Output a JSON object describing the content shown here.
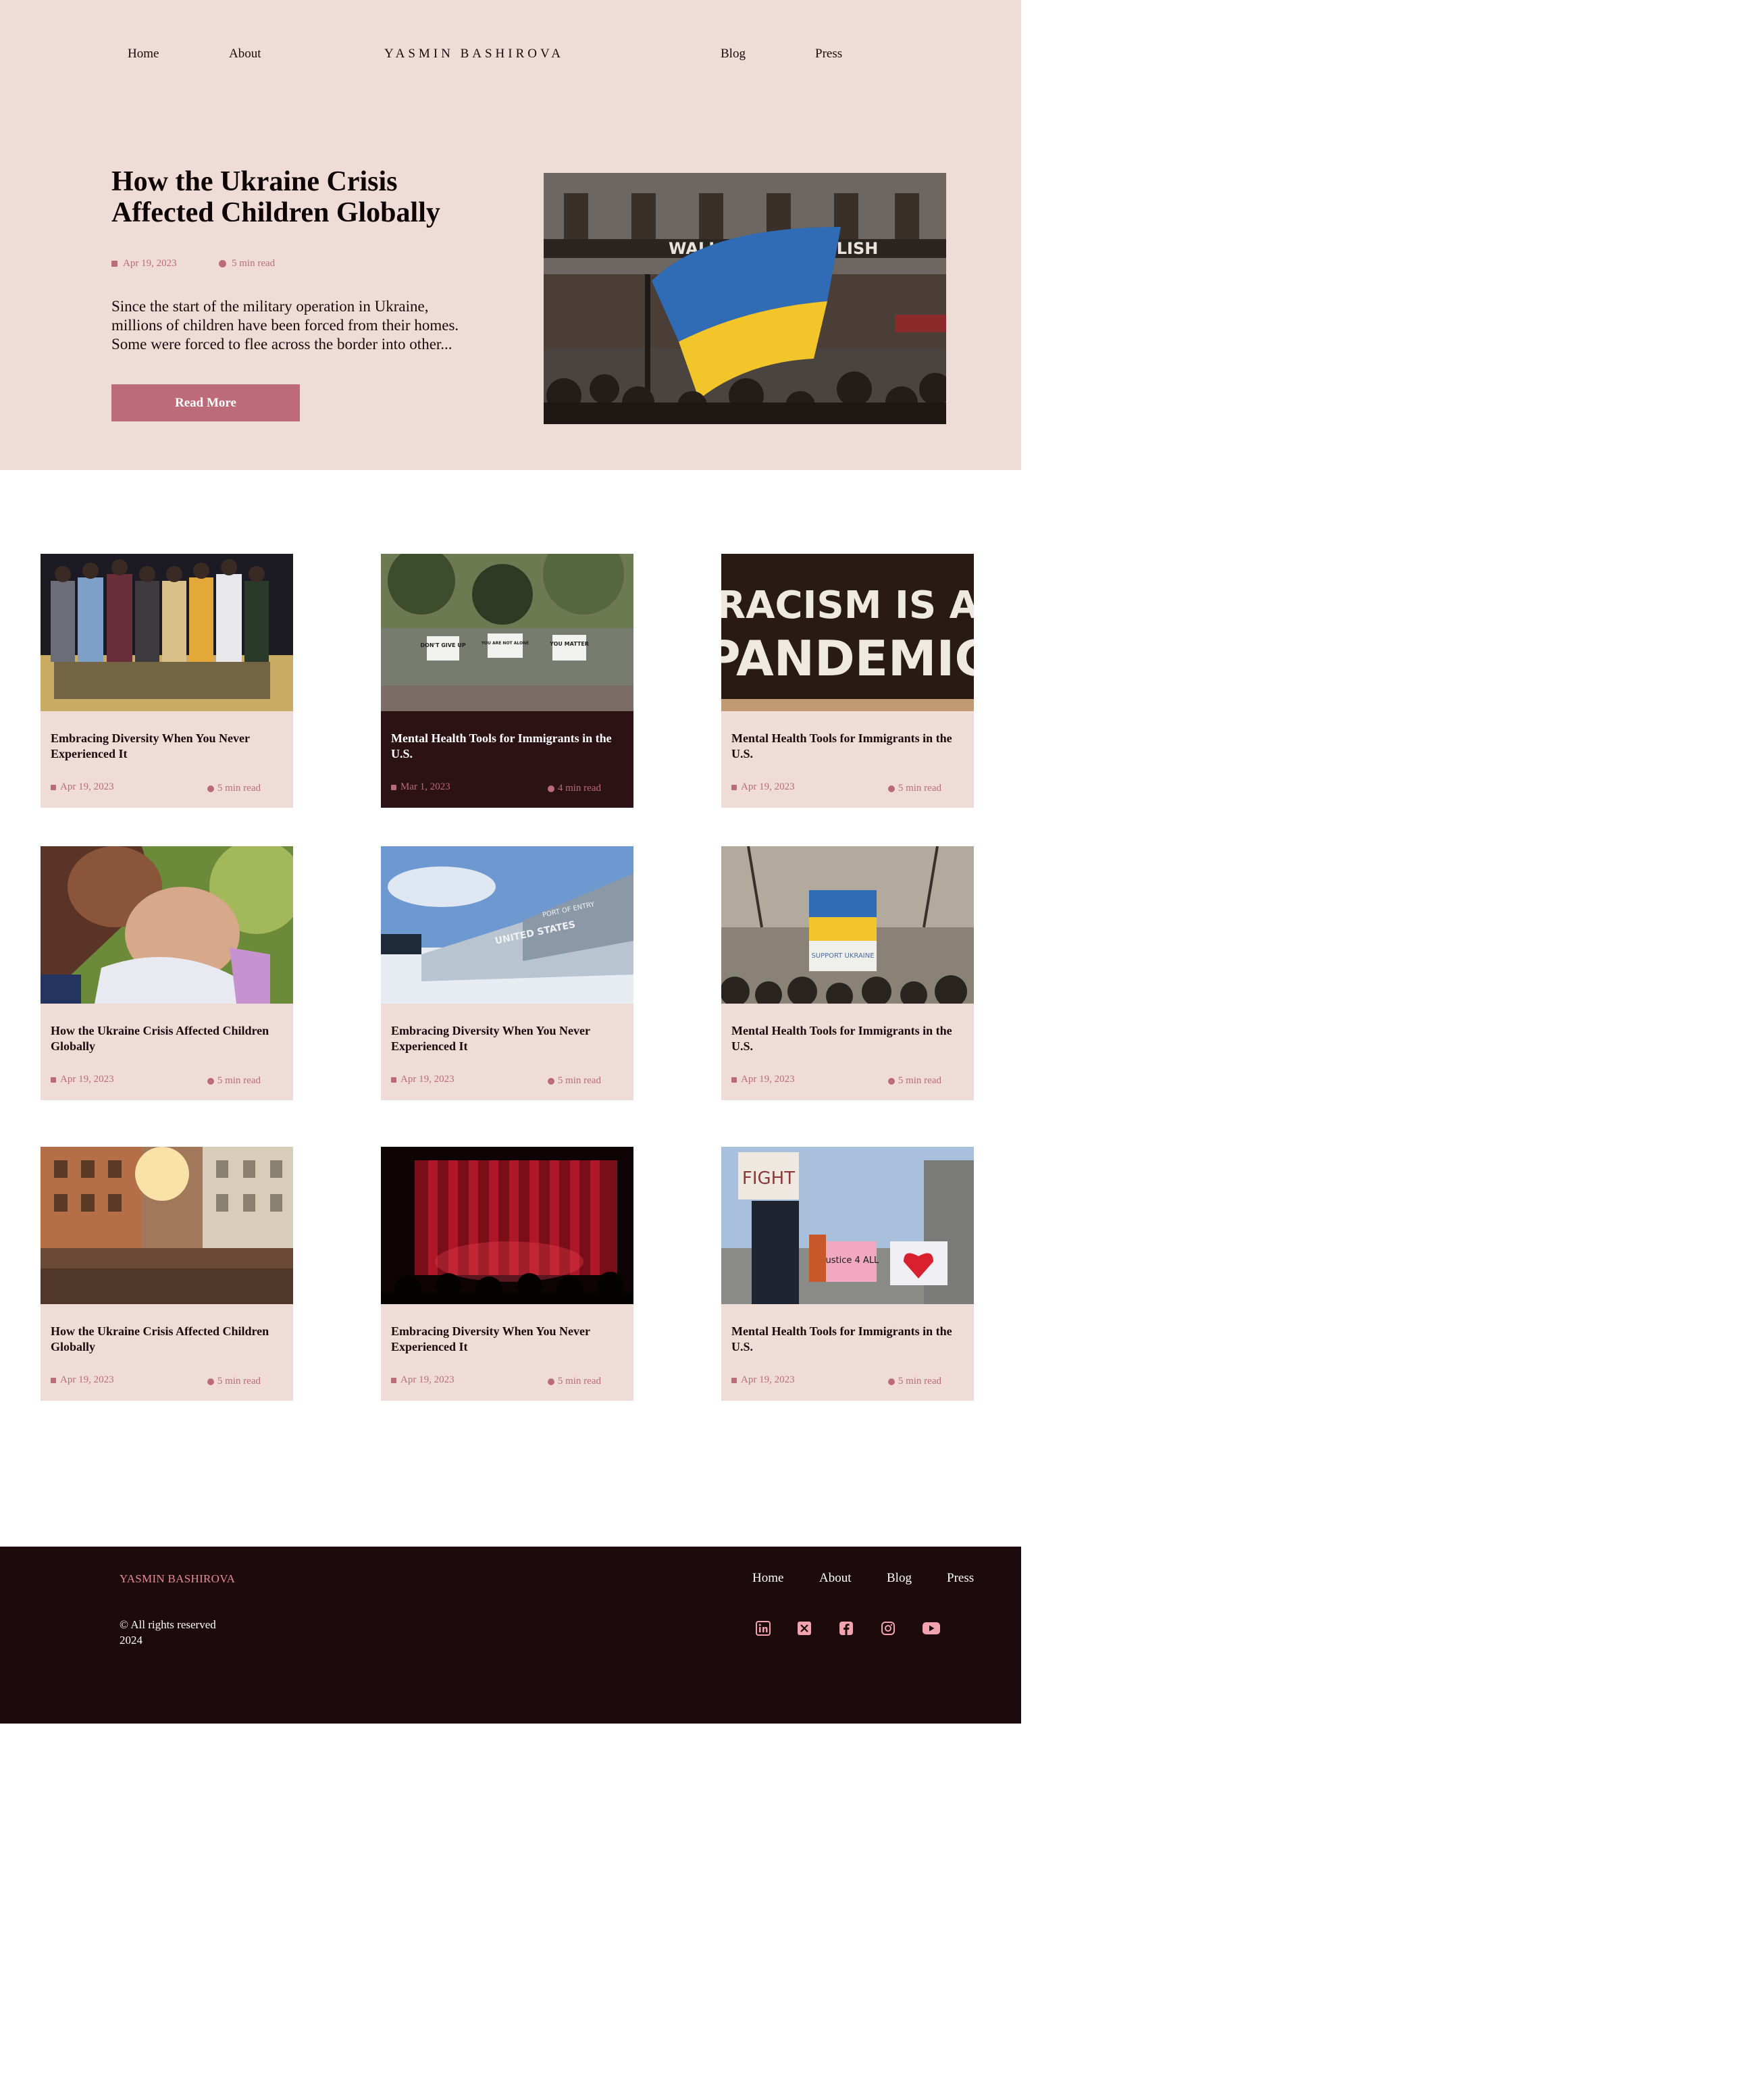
{
  "nav": {
    "home": "Home",
    "about": "About",
    "brand": "YASMIN BASHIROVA",
    "blog": "Blog",
    "press": "Press"
  },
  "hero": {
    "title": "How the Ukraine Crisis Affected Children Globally",
    "date": "Apr 19, 2023",
    "read_time": "5 min read",
    "excerpt": "Since the start of the military operation in Ukraine, millions of children have been forced from their homes. Some were forced to flee across the border into other...",
    "button": "Read More",
    "image_sign": "WALL STREET ENGLISH"
  },
  "cards": [
    {
      "title": "Embracing Diversity When You Never Experienced It",
      "date": "Apr 19, 2023",
      "read_time": "5 min read",
      "image": "group-hugging-photo"
    },
    {
      "title": "Mental Health Tools for Immigrants in the U.S.",
      "date": "Mar 1, 2023",
      "read_time": "4 min read",
      "image": "fence-signs-photo",
      "signs": [
        "DON'T GIVE UP",
        "YOU ARE NOT ALONE",
        "YOU MATTER"
      ]
    },
    {
      "title": "Mental Health Tools for Immigrants in the U.S.",
      "date": "Apr 19, 2023",
      "read_time": "5 min read",
      "image": "racism-sign-photo",
      "sign_line1": "RACISM IS A",
      "sign_line2": "PANDEMIC"
    },
    {
      "title": "How the Ukraine Crisis Affected Children Globally",
      "date": "Apr 19, 2023",
      "read_time": "5 min read",
      "image": "mother-baby-photo"
    },
    {
      "title": "Embracing Diversity When You Never Experienced It",
      "date": "Apr 19, 2023",
      "read_time": "5 min read",
      "image": "port-of-entry-photo",
      "sign_a": "UNITED STATES",
      "sign_b": "PORT OF ENTRY"
    },
    {
      "title": "Mental Health Tools for Immigrants in the U.S.",
      "date": "Apr 19, 2023",
      "read_time": "5 min read",
      "image": "support-ukraine-photo",
      "sign": "SUPPORT UKRAINE"
    },
    {
      "title": "How the Ukraine Crisis Affected Children Globally",
      "date": "Apr 19, 2023",
      "read_time": "5 min read",
      "image": "city-crowd-photo"
    },
    {
      "title": "Embracing Diversity When You Never Experienced It",
      "date": "Apr 19, 2023",
      "read_time": "5 min read",
      "image": "red-curtain-photo"
    },
    {
      "title": "Mental Health Tools for Immigrants in the U.S.",
      "date": "Apr 19, 2023",
      "read_time": "5 min read",
      "image": "protest-signs-photo",
      "signs": [
        "FIGHT",
        "Justice 4 ALL"
      ]
    }
  ],
  "footer": {
    "brand": "YASMIN BASHIROVA",
    "copyright": "© All rights reserved 2024",
    "links": [
      "Home",
      "About",
      "Blog",
      "Press"
    ],
    "social_icons": [
      "linkedin-icon",
      "x-icon",
      "facebook-icon",
      "instagram-icon",
      "youtube-icon"
    ]
  },
  "colors": {
    "hero_bg": "#efdcd7",
    "accent": "#bd6b7b",
    "meta_text": "#b96c78",
    "footer_bg": "#1c0a0c",
    "dark_card": "#2c1115",
    "footer_brand": "#e88a9a"
  }
}
